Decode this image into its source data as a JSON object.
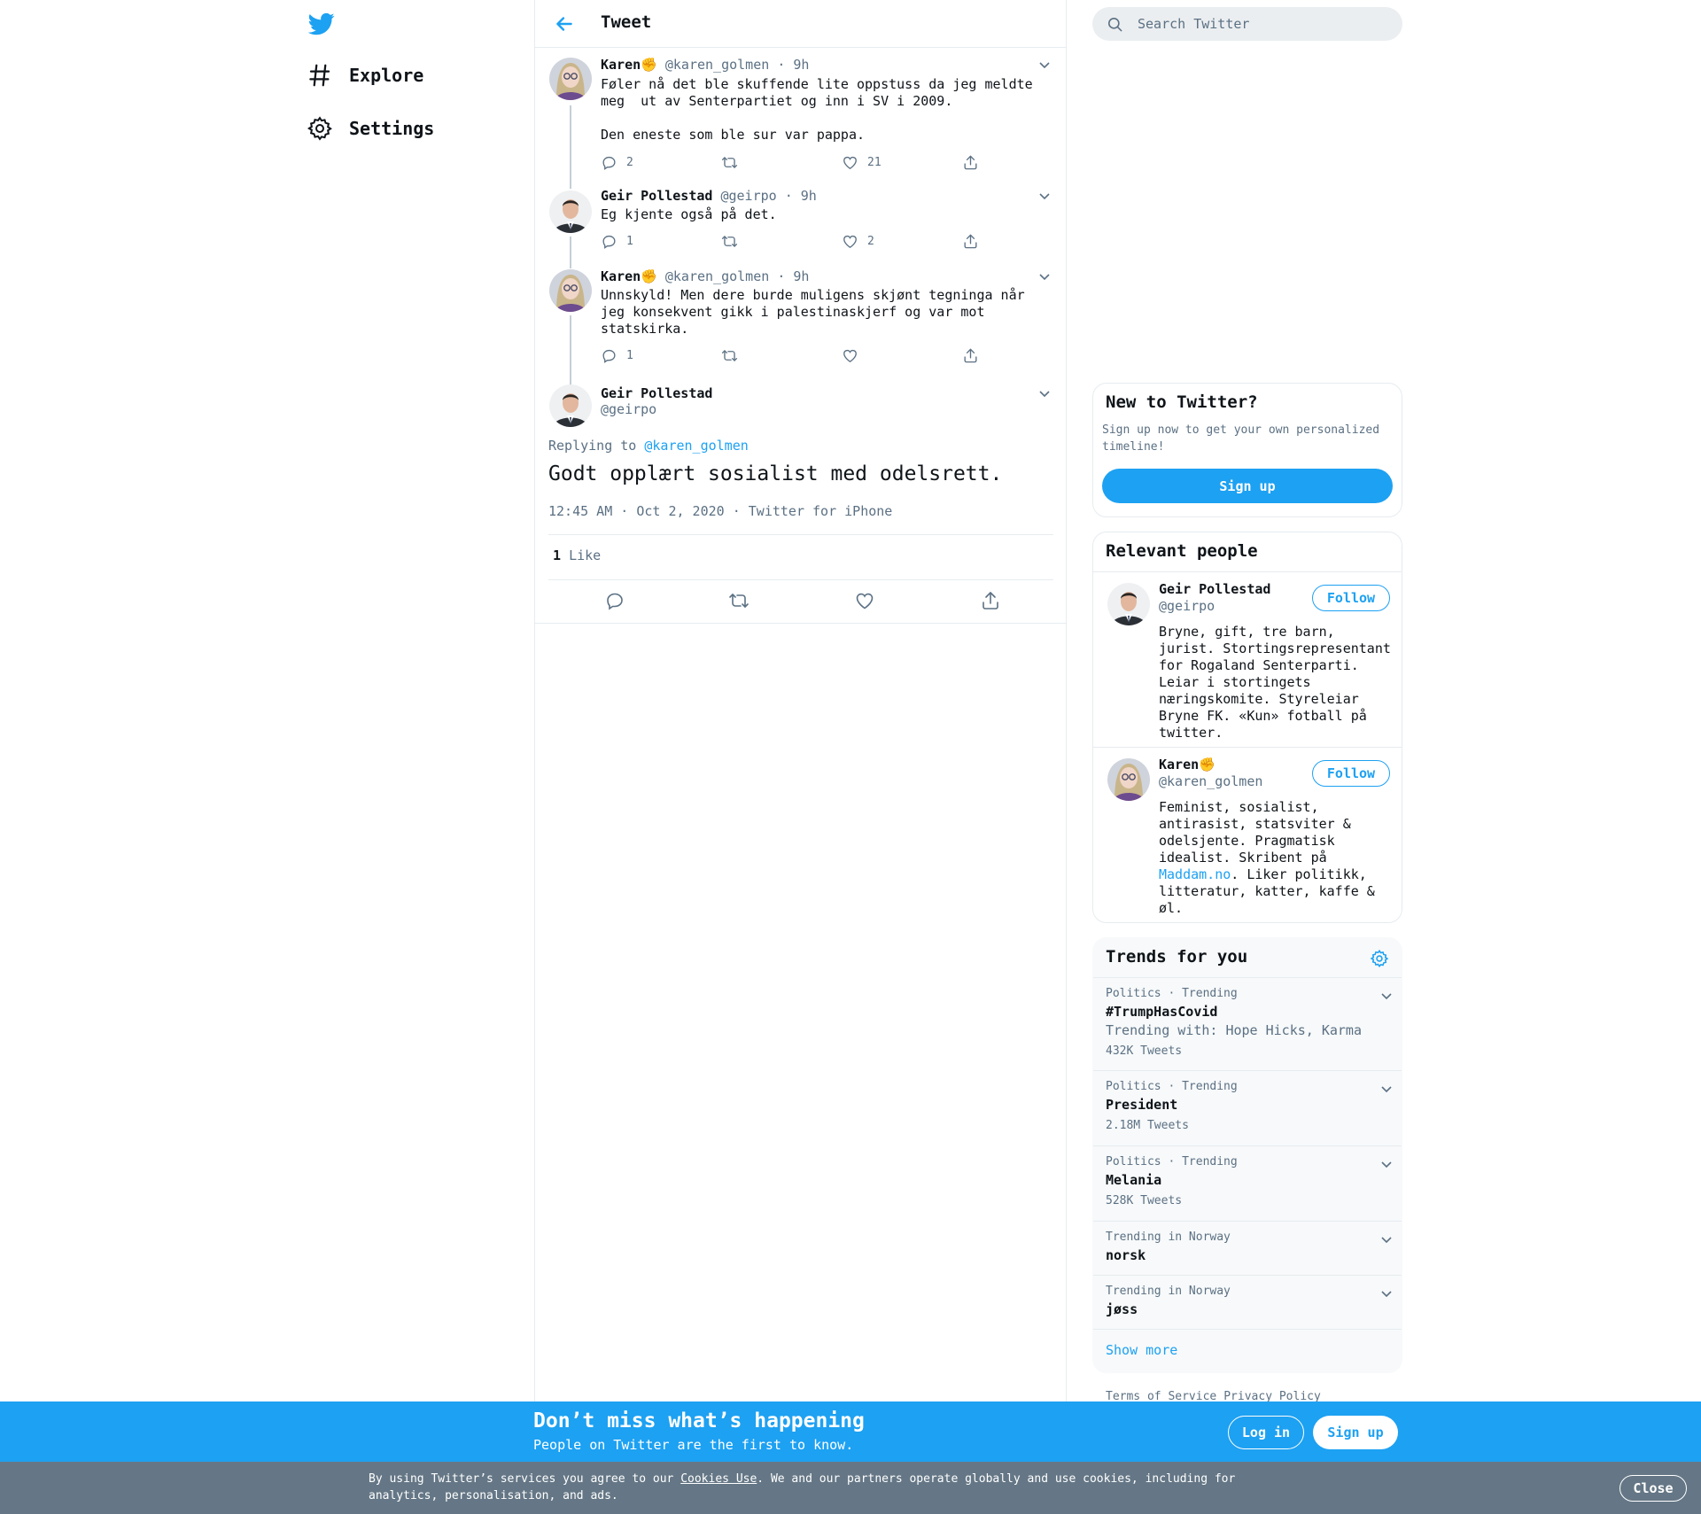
{
  "nav": {
    "items": [
      {
        "label": "Explore",
        "icon": "hashtag-icon"
      },
      {
        "label": "Settings",
        "icon": "gear-icon"
      }
    ]
  },
  "header": {
    "title": "Tweet"
  },
  "thread": [
    {
      "name": "Karen✊",
      "handle": "@karen_golmen",
      "time": "9h",
      "text": "Føler nå det ble skuffende lite oppstuss da jeg meldte\nmeg  ut av Senterpartiet og inn i SV i 2009.\n\nDen eneste som ble sur var pappa.",
      "replies": "2",
      "retweets": "",
      "likes": "21"
    },
    {
      "name": "Geir Pollestad",
      "handle": "@geirpo",
      "time": "9h",
      "text": "Eg kjente også på det.",
      "replies": "1",
      "retweets": "",
      "likes": "2"
    },
    {
      "name": "Karen✊",
      "handle": "@karen_golmen",
      "time": "9h",
      "text": "Unnskyld! Men dere burde muligens skjønt tegninga når\njeg konsekvent gikk i palestinaskjerf og var mot\nstatskirka.",
      "replies": "1",
      "retweets": "",
      "likes": ""
    }
  ],
  "main_tweet": {
    "name": "Geir Pollestad",
    "handle": "@geirpo",
    "replying_label": "Replying to",
    "replying_to": "@karen_golmen",
    "text": "Godt opplært sosialist med odelsrett.",
    "timestamp": "12:45 AM · Oct 2, 2020",
    "source": "Twitter for iPhone",
    "like_count": "1",
    "like_label": "Like"
  },
  "search": {
    "placeholder": "Search Twitter"
  },
  "new_to_twitter": {
    "title": "New to Twitter?",
    "subtitle": "Sign up now to get your own personalized timeline!",
    "button": "Sign up"
  },
  "relevant_people": {
    "title": "Relevant people",
    "people": [
      {
        "name": "Geir Pollestad",
        "handle": "@geirpo",
        "follow": "Follow",
        "bio": "Bryne, gift, tre barn, jurist. Stortingsrepresentant for Rogaland Senterparti. Leiar i stortingets næringskomite. Styreleiar Bryne FK. «Kun» fotball på twitter."
      },
      {
        "name": "Karen✊",
        "handle": "@karen_golmen",
        "follow": "Follow",
        "bio_before": "Feminist, sosialist, antirasist, statsviter & odelsjente. Pragmatisk idealist. Skribent på ",
        "bio_link": "Maddam.no",
        "bio_after": ". Liker politikk, litteratur, katter, kaffe & øl."
      }
    ]
  },
  "trends": {
    "title": "Trends for you",
    "items": [
      {
        "context": "Politics · Trending",
        "name": "#TrumpHasCovid",
        "with": "Trending with: Hope Hicks, Karma",
        "count": "432K Tweets"
      },
      {
        "context": "Politics · Trending",
        "name": "President",
        "with": "",
        "count": "2.18M Tweets"
      },
      {
        "context": "Politics · Trending",
        "name": "Melania",
        "with": "",
        "count": "528K Tweets"
      },
      {
        "context": "Trending in Norway",
        "name": "norsk",
        "with": "",
        "count": ""
      },
      {
        "context": "Trending in Norway",
        "name": "jøss",
        "with": "",
        "count": ""
      }
    ],
    "show_more": "Show more"
  },
  "footer": {
    "terms": "Terms of Service",
    "privacy": "Privacy Policy"
  },
  "banner": {
    "title": "Don’t miss what’s happening",
    "subtitle": "People on Twitter are the first to know.",
    "login": "Log in",
    "signup": "Sign up"
  },
  "cookie": {
    "text_before": "By using Twitter’s services you agree to our ",
    "link": "Cookies Use",
    "text_after": ". We and our partners operate globally and use cookies, including for analytics, personalisation, and ads.",
    "close": "Close"
  },
  "colors": {
    "accent": "#1da1f2",
    "text": "#0f1419",
    "secondary": "#5b7083",
    "border": "#e6ecf0",
    "cookie_bg": "#657786"
  }
}
